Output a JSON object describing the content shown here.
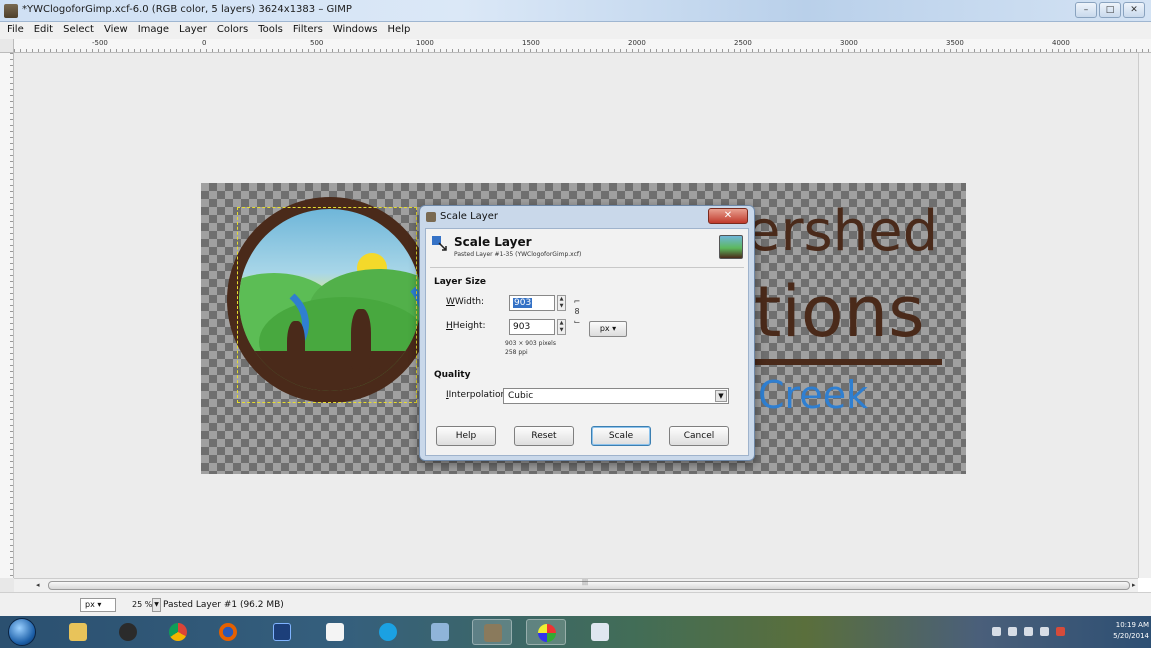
{
  "window": {
    "title": "*YWClogoforGimp.xcf-6.0 (RGB color, 5 layers) 3624x1383 – GIMP",
    "controls": [
      "–",
      "□",
      "✕"
    ]
  },
  "menu": [
    "File",
    "Edit",
    "Select",
    "View",
    "Image",
    "Layer",
    "Colors",
    "Tools",
    "Filters",
    "Windows",
    "Help"
  ],
  "ruler": {
    "ticks": [
      "-500",
      "0",
      "500",
      "1000",
      "1500",
      "2000",
      "2500",
      "3000",
      "3500",
      "4000"
    ]
  },
  "canvas": {
    "logo_text_line1": "ershed",
    "logo_text_line2": "tions",
    "logo_text_line3": "Creek"
  },
  "dialog": {
    "window_title": "Scale Layer",
    "close_label": "✕",
    "header_title": "Scale Layer",
    "header_subtitle": "Pasted Layer #1-35 (YWClogoforGimp.xcf)",
    "layer_size_label": "Layer Size",
    "width_label": "Width:",
    "width_value": "903",
    "height_label": "Height:",
    "height_value": "903",
    "unit": "px",
    "pixels_info": "903 × 903 pixels",
    "ppi_info": "258 ppi",
    "quality_label": "Quality",
    "interpolation_label": "Interpolation:",
    "interpolation_value": "Cubic",
    "buttons": {
      "help": "Help",
      "reset": "Reset",
      "scale": "Scale",
      "cancel": "Cancel"
    }
  },
  "status": {
    "unit": "px",
    "zoom": "25 %",
    "message": "Pasted Layer #1 (96.2 MB)"
  },
  "taskbar": {
    "time": "10:19 AM",
    "date": "5/20/2014",
    "apps": [
      "explorer",
      "itunes",
      "chrome",
      "firefox",
      "photoshop",
      "notepad",
      "skype",
      "calculator",
      "gimp",
      "paint",
      "file-manager"
    ]
  },
  "colors": {
    "logo_brown": "#4a2a1a",
    "logo_blue": "#2f7fd1",
    "logo_green": "#4caf50",
    "dialog_frame": "#c9d8ea"
  }
}
